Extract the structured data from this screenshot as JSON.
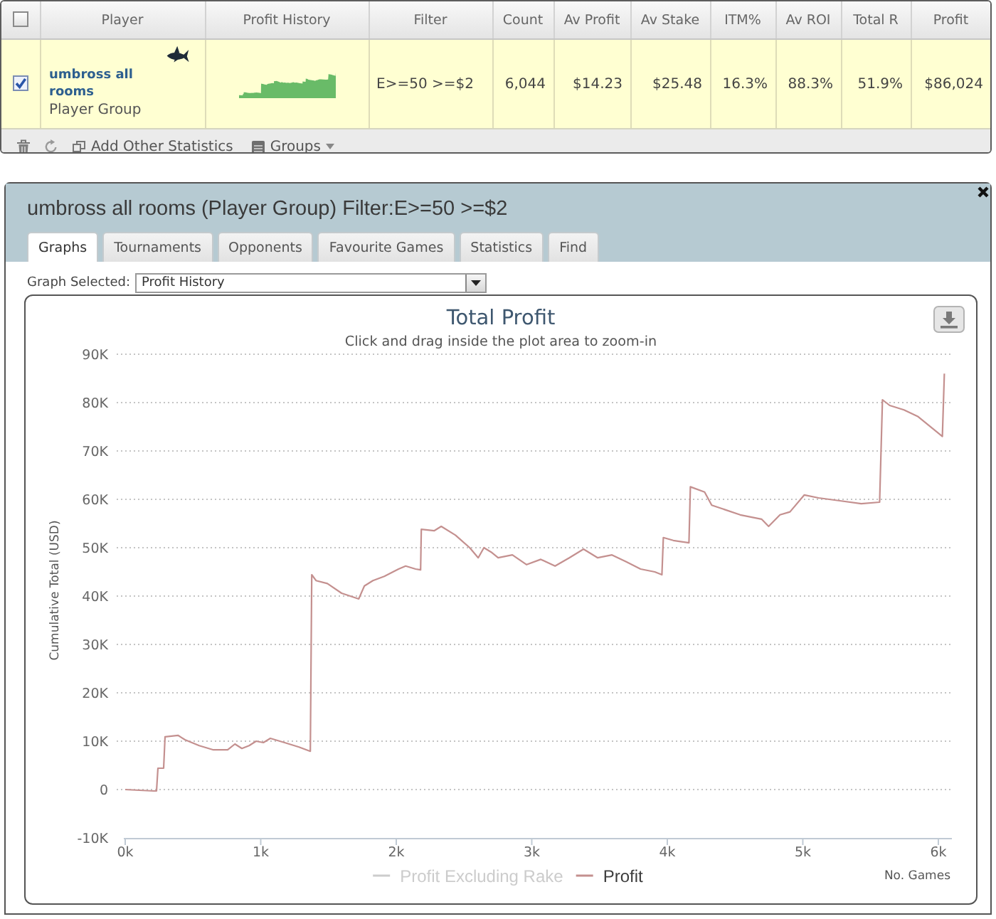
{
  "stats_table": {
    "select_all": {
      "checked": false
    },
    "columns": [
      "Player",
      "Profit History",
      "Filter",
      "Count",
      "Av Profit",
      "Av Stake",
      "ITM%",
      "Av ROI",
      "Total R",
      "Profit"
    ],
    "rows": [
      {
        "checked": true,
        "player": "umbross all rooms",
        "player_type": "Player Group",
        "filter": "E>=50 >=$2",
        "stats": [
          "6,044",
          "$14.23",
          "$25.48",
          "16.3%",
          "88.3%",
          "51.9%",
          "$86,024"
        ]
      }
    ],
    "toolbar": {
      "add_statistics": "Add Other Statistics",
      "groups": "Groups"
    }
  },
  "dialog": {
    "title": "umbross all rooms (Player Group) Filter:E>=50 >=$2",
    "tabs": [
      {
        "label": "Graphs",
        "selected": true
      },
      {
        "label": "Tournaments",
        "selected": false
      },
      {
        "label": "Opponents",
        "selected": false
      },
      {
        "label": "Favourite Games",
        "selected": false
      },
      {
        "label": "Statistics",
        "selected": false
      },
      {
        "label": "Find",
        "selected": false
      }
    ],
    "graph_selector": {
      "label": "Graph Selected:",
      "value": "Profit History"
    },
    "chart": {
      "subtitle": "Click and drag inside the plot area to zoom-in",
      "legend": [
        {
          "shown": false
        },
        {
          "shown": true
        }
      ],
      "chart_data": {
        "type": "line",
        "title": "Total Profit",
        "xlabel": "No. Games",
        "ylabel": "Cumulative Total (USD)",
        "grid": true,
        "x": [
          0,
          210,
          231,
          242,
          284,
          294,
          389,
          441,
          546,
          651,
          756,
          809,
          861,
          914,
          966,
          1019,
          1071,
          1176,
          1282,
          1366,
          1376,
          1408,
          1492,
          1597,
          1723,
          1765,
          1828,
          1912,
          2017,
          2069,
          2143,
          2180,
          2185,
          2279,
          2332,
          2437,
          2542,
          2605,
          2647,
          2700,
          2752,
          2857,
          2962,
          3067,
          3172,
          3277,
          3382,
          3487,
          3592,
          3697,
          3803,
          3908,
          3960,
          3971,
          4044,
          4160,
          4170,
          4275,
          4328,
          4538,
          4695,
          4748,
          4832,
          4905,
          5011,
          5116,
          5273,
          5431,
          5567,
          5588,
          5641,
          5746,
          5851,
          6008,
          6030,
          6044
        ],
        "series": [
          {
            "name": "Profit Excluding Rake",
            "color": "#cccccc",
            "values": [
              null,
              null,
              null,
              null,
              null,
              null,
              null,
              null,
              null,
              null,
              null,
              null,
              null,
              null,
              null,
              null,
              null,
              null,
              null,
              null,
              null,
              null,
              null,
              null,
              null,
              null,
              null,
              null,
              null,
              null,
              null,
              null,
              null,
              null,
              null,
              null,
              null,
              null,
              null,
              null,
              null,
              null,
              null,
              null,
              null,
              null,
              null,
              null,
              null,
              null,
              null,
              null,
              null,
              null,
              null,
              null,
              null,
              null,
              null,
              null,
              null,
              null,
              null,
              null,
              null,
              null,
              null,
              null,
              null,
              null,
              null,
              null,
              null,
              null,
              null,
              null
            ]
          },
          {
            "name": "Profit",
            "color": "#c4908f",
            "values": [
              0,
              -300,
              -300,
              4400,
              4400,
              10900,
              11200,
              10300,
              9100,
              8200,
              8200,
              9400,
              8500,
              9100,
              10000,
              9700,
              10600,
              9700,
              8800,
              7900,
              44400,
              43200,
              42600,
              40600,
              39400,
              42100,
              43200,
              44100,
              45600,
              46200,
              45600,
              45400,
              53800,
              53500,
              54400,
              52600,
              50000,
              47900,
              50000,
              49100,
              47900,
              48500,
              46500,
              47600,
              46200,
              47900,
              49700,
              47900,
              48500,
              47100,
              45600,
              45000,
              44400,
              52100,
              51500,
              51000,
              62600,
              61500,
              58800,
              56800,
              55900,
              54400,
              56800,
              57400,
              60900,
              60300,
              59700,
              59100,
              59400,
              80600,
              79400,
              78500,
              77100,
              73500,
              73000,
              86000
            ]
          }
        ],
        "xlim": [
          0,
          6100
        ],
        "ylim": [
          -10000,
          90000
        ],
        "xticks": [
          {
            "value": 0,
            "label": "0k"
          },
          {
            "value": 1000,
            "label": "1k"
          },
          {
            "value": 2000,
            "label": "2k"
          },
          {
            "value": 3000,
            "label": "3k"
          },
          {
            "value": 4000,
            "label": "4k"
          },
          {
            "value": 5000,
            "label": "5k"
          },
          {
            "value": 6000,
            "label": "6k"
          }
        ],
        "yticks": [
          {
            "value": -10000,
            "label": "-10K"
          },
          {
            "value": 0,
            "label": "0"
          },
          {
            "value": 10000,
            "label": "10K"
          },
          {
            "value": 20000,
            "label": "20K"
          },
          {
            "value": 30000,
            "label": "30K"
          },
          {
            "value": 40000,
            "label": "40K"
          },
          {
            "value": 50000,
            "label": "50K"
          },
          {
            "value": 60000,
            "label": "60K"
          },
          {
            "value": 70000,
            "label": "70K"
          },
          {
            "value": 80000,
            "label": "80K"
          },
          {
            "value": 90000,
            "label": "90K"
          }
        ]
      }
    }
  }
}
